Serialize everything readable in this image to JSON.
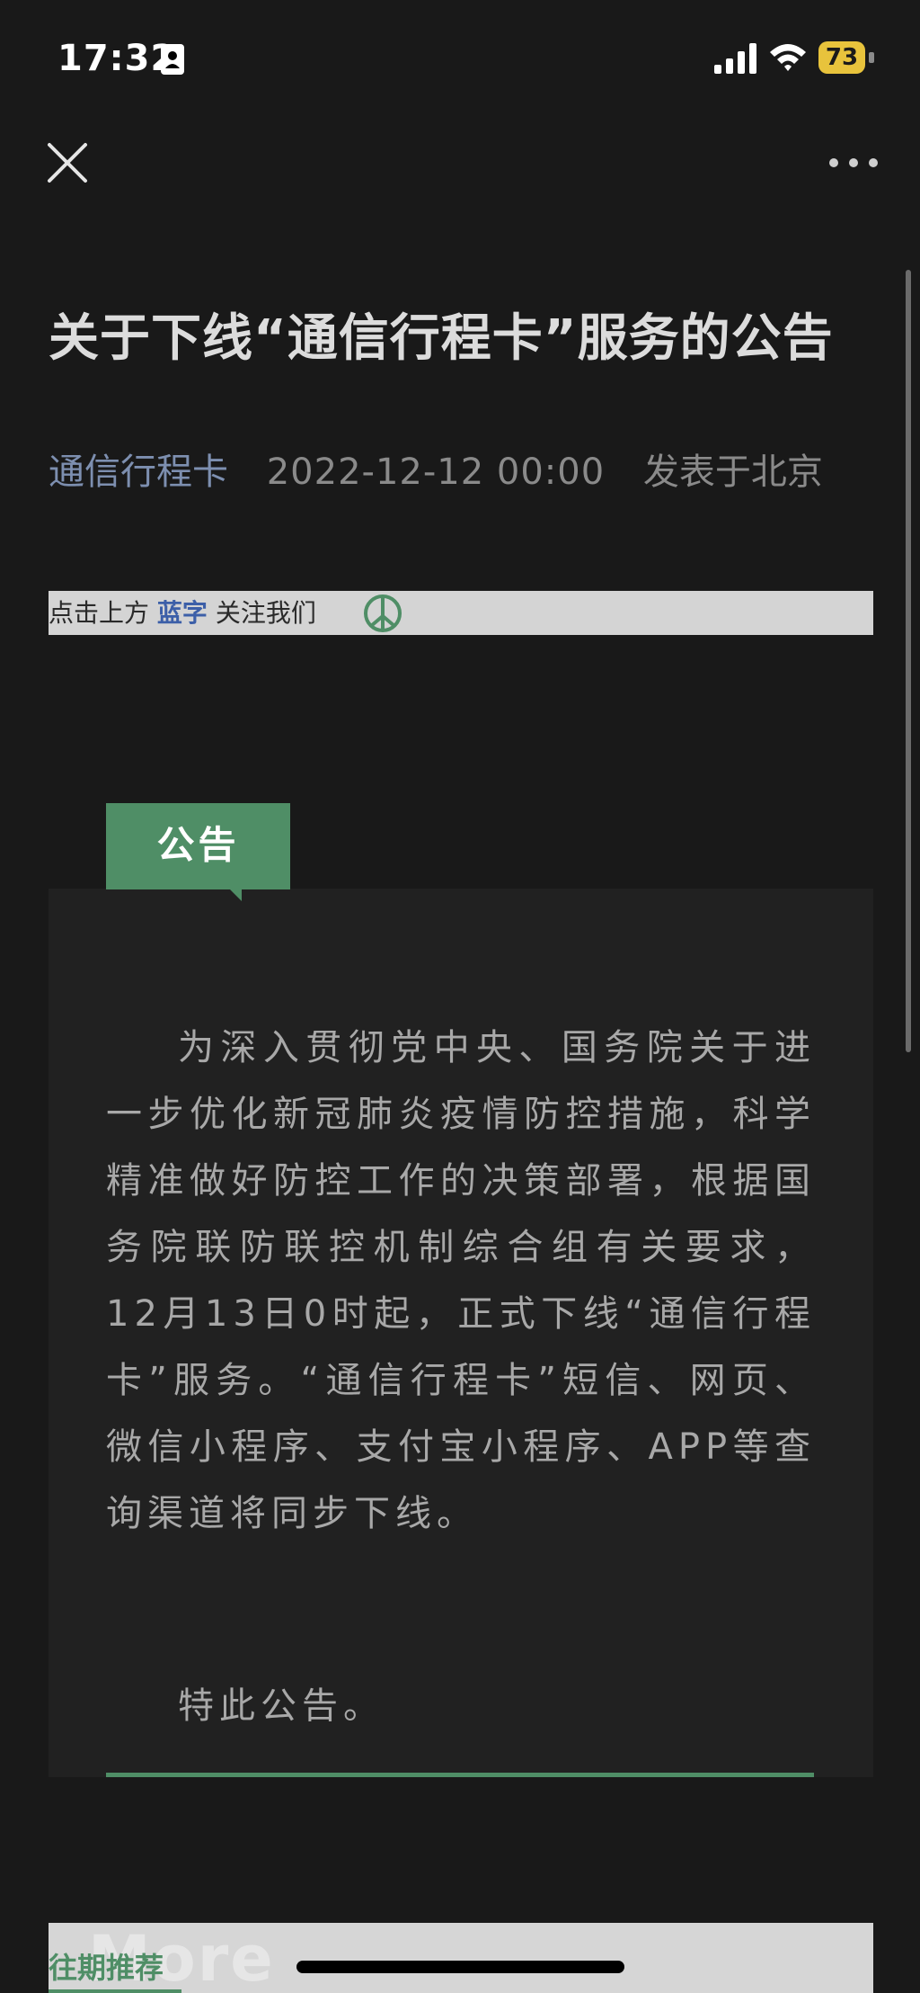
{
  "status_bar": {
    "time": "17:32",
    "battery": "73",
    "icons": [
      "contact-card-icon",
      "cellular-signal-icon",
      "wifi-icon",
      "battery-icon"
    ]
  },
  "nav": {
    "close_icon": "close-icon",
    "more_icon": "more-dots-icon"
  },
  "article": {
    "title": "关于下线“通信行程卡”服务的公告",
    "account": "通信行程卡",
    "date": "2022-12-12 00:00",
    "location": "发表于北京"
  },
  "follow_banner": {
    "prefix": "点击上方",
    "highlight": "蓝字",
    "suffix": "关注我们"
  },
  "notice": {
    "tag": "公告",
    "body": "为深入贯彻党中央、国务院关于进一步优化新冠肺炎疫情防控措施，科学精准做好防控工作的决策部署，根据国务院联防联控机制综合组有关要求，12月13日0时起，正式下线“通信行程卡”服务。“通信行程卡”短信、网页、微信小程序、支付宝小程序、APP等查询渠道将同步下线。",
    "closing": "特此公告。"
  },
  "recommend": {
    "watermark": "More",
    "label": "往期推荐"
  },
  "colors": {
    "background": "#191919",
    "accent_green": "#4f8e66",
    "link_blue": "#7d8fb0",
    "battery_yellow": "#e8c33c"
  }
}
